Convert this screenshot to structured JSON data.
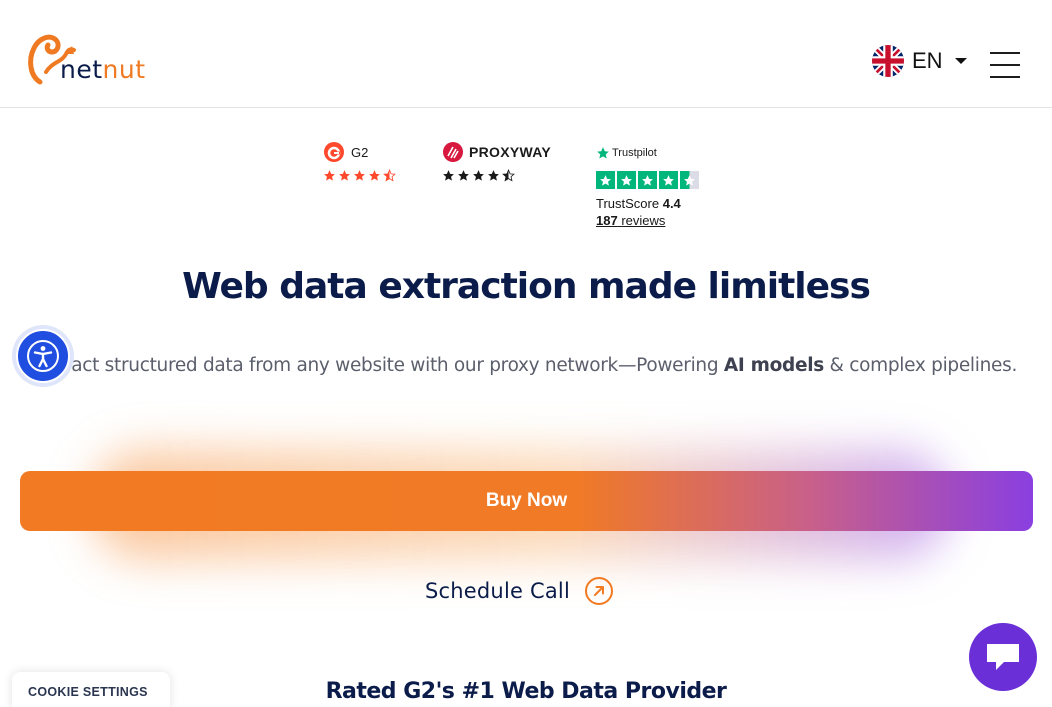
{
  "header": {
    "logo_text_dark": "net",
    "logo_text_orange": "nut",
    "language": {
      "code": "EN",
      "flag_icon": "uk-flag-icon"
    },
    "menu_icon": "hamburger-menu-icon"
  },
  "ratings": {
    "g2": {
      "name": "G2",
      "rating": 4.5,
      "star_color": "#ff492c"
    },
    "proxyway": {
      "name": "PROXYWAY",
      "rating": 4.5
    },
    "trustpilot": {
      "name": "Trustpilot",
      "trustscore_label": "TrustScore",
      "trustscore_value": "4.4",
      "reviews_count": "187",
      "reviews_label": "reviews",
      "star_color": "#00b67a"
    }
  },
  "hero": {
    "title": "Web data extraction made limitless",
    "subtitle_pre": "Extract structured data from any website with our proxy network—Powering ",
    "subtitle_bold": "AI models",
    "subtitle_post": " & complex pipelines."
  },
  "cta": {
    "buy_label": "Buy Now",
    "schedule_label": "Schedule Call"
  },
  "section": {
    "rated_heading": "Rated G2's #1 Web Data Provider"
  },
  "cookie": {
    "label": "COOKIE SETTINGS"
  },
  "colors": {
    "brand_orange": "#f27a22",
    "brand_navy": "#0b1c4a",
    "brand_purple": "#8a3fe0",
    "accessibility_blue": "#1f4ee0",
    "chat_purple": "#6a2fd6"
  }
}
